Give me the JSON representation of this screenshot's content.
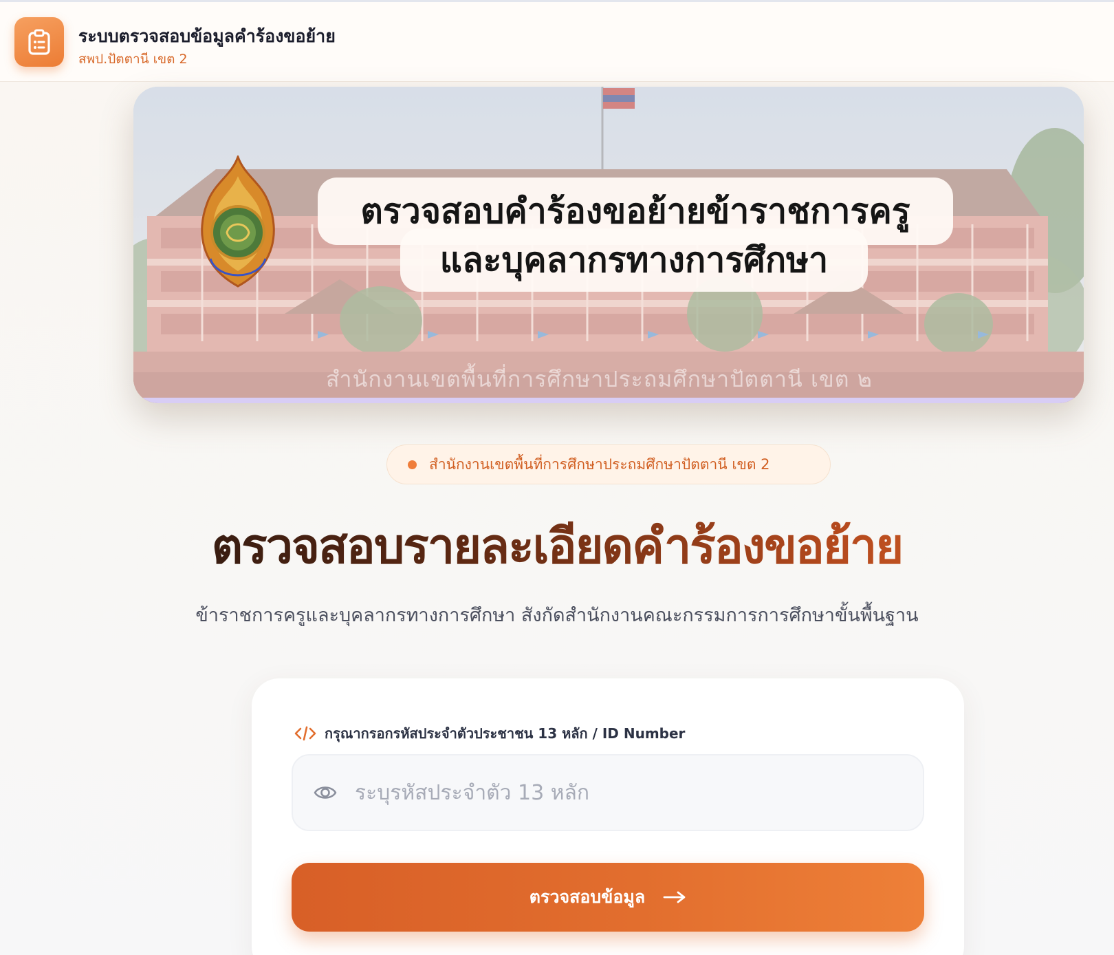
{
  "header": {
    "icon": "clipboard-list-icon",
    "title": "ระบบตรวจสอบข้อมูลคำร้องขอย้าย",
    "subtitle": "สพป.ปัตตานี เขต 2"
  },
  "banner": {
    "title_line1": "ตรวจสอบคำร้องขอย้ายข้าราชการครู",
    "title_line2": "และบุคลากรทางการศึกษา",
    "caption": "สำนักงานเขตพื้นที่การศึกษาประถมศึกษาปัตตานี เขต ๒",
    "logo": "obec-emblem-logo"
  },
  "badge": {
    "text": "สำนักงานเขตพื้นที่การศึกษาประถมศึกษาปัตตานี เขต 2"
  },
  "hero": {
    "title": "ตรวจสอบรายละเอียดคำร้องขอย้าย",
    "subtitle": "ข้าราชการครูและบุคลากรทางการศึกษา สังกัดสำนักงานคณะกรรมการการศึกษาขั้นพื้นฐาน"
  },
  "form": {
    "label": "กรุณากรอกรหัสประจำตัวประชาชน 13 หลัก / ID Number",
    "label_icon": "code-icon",
    "input_icon": "eye-icon",
    "input_value": "",
    "input_placeholder": "ระบุรหัสประจำตัว 13 หลัก",
    "submit_label": "ตรวจสอบข้อมูล",
    "submit_icon": "arrow-right-icon"
  },
  "colors": {
    "accent": "#e26e2e",
    "accent_light": "#f6a060",
    "badge_bg": "#fff3e8",
    "text_dark": "#1a1c2b"
  }
}
